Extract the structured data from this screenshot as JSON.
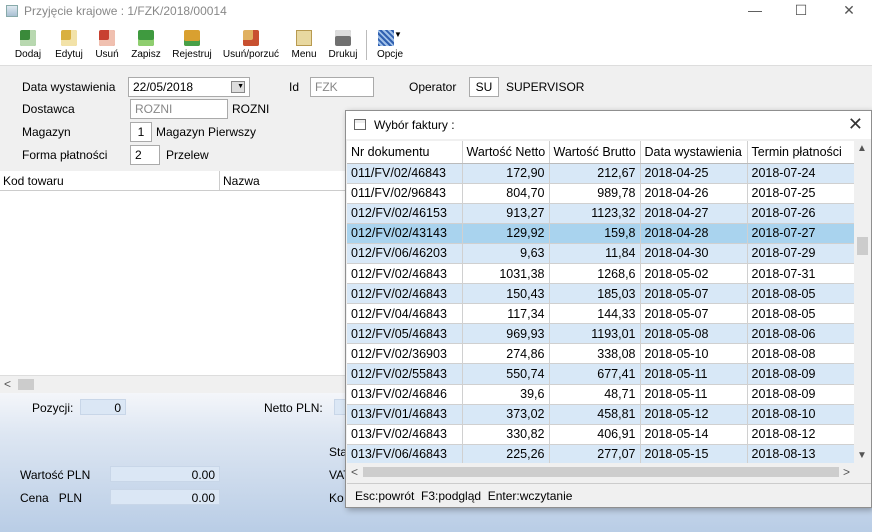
{
  "window": {
    "title": "Przyjęcie krajowe : 1/FZK/2018/00014",
    "minimize": "—",
    "maximize": "☐",
    "close": "✕"
  },
  "toolbar": {
    "buttons": [
      {
        "label": "Dodaj",
        "icon": "add-icon"
      },
      {
        "label": "Edytuj",
        "icon": "edit-icon"
      },
      {
        "label": "Usuń",
        "icon": "delete-icon"
      },
      {
        "label": "Zapisz",
        "icon": "save-icon"
      },
      {
        "label": "Rejestruj",
        "icon": "register-icon"
      },
      {
        "label": "Usuń/porzuć",
        "icon": "discard-icon"
      },
      {
        "label": "Menu",
        "icon": "menu-icon"
      },
      {
        "label": "Drukuj",
        "icon": "print-icon"
      },
      {
        "label": "Opcje",
        "icon": "options-icon"
      }
    ]
  },
  "form": {
    "date_label": "Data wystawienia",
    "date_value": "22/05/2018",
    "id_label": "Id",
    "id_value": "FZK",
    "operator_label": "Operator",
    "operator_code": "SU",
    "operator_name": "SUPERVISOR",
    "supplier_label": "Dostawca",
    "supplier_value": "ROZNI",
    "supplier_name": "ROZNI",
    "warehouse_label": "Magazyn",
    "warehouse_code": "1",
    "warehouse_name": "Magazyn Pierwszy",
    "payment_label": "Forma płatności",
    "payment_code": "2",
    "payment_name": "Przelew"
  },
  "items_grid": {
    "columns": [
      "Kod towaru",
      "Nazwa"
    ]
  },
  "footer": {
    "positions_label": "Pozycji:",
    "positions_value": "0",
    "netto_label": "Netto PLN:",
    "value_label": "Wartość PLN",
    "value_value": "0.00",
    "price_label": "Cena   PLN",
    "price_value": "0.00",
    "partial_sta": "Sta",
    "partial_vat": "VAT",
    "partial_ko": "Ko"
  },
  "dialog": {
    "title": "Wybór faktury :",
    "close": "✕",
    "columns": [
      "Nr dokumentu",
      "Wartość Netto",
      "Wartość Brutto",
      "Data wystawienia",
      "Termin płatności"
    ],
    "rows": [
      [
        "011/FV/02/46843",
        "172,90",
        "212,67",
        "2018-04-25",
        "2018-07-24"
      ],
      [
        "011/FV/02/96843",
        "804,70",
        "989,78",
        "2018-04-26",
        "2018-07-25"
      ],
      [
        "012/FV/02/46153",
        "913,27",
        "1123,32",
        "2018-04-27",
        "2018-07-26"
      ],
      [
        "012/FV/02/43143",
        "129,92",
        "159,8",
        "2018-04-28",
        "2018-07-27"
      ],
      [
        "012/FV/06/46203",
        "9,63",
        "11,84",
        "2018-04-30",
        "2018-07-29"
      ],
      [
        "012/FV/02/46843",
        "1031,38",
        "1268,6",
        "2018-05-02",
        "2018-07-31"
      ],
      [
        "012/FV/02/46843",
        "150,43",
        "185,03",
        "2018-05-07",
        "2018-08-05"
      ],
      [
        "012/FV/04/46843",
        "117,34",
        "144,33",
        "2018-05-07",
        "2018-08-05"
      ],
      [
        "012/FV/05/46843",
        "969,93",
        "1193,01",
        "2018-05-08",
        "2018-08-06"
      ],
      [
        "012/FV/02/36903",
        "274,86",
        "338,08",
        "2018-05-10",
        "2018-08-08"
      ],
      [
        "012/FV/02/55843",
        "550,74",
        "677,41",
        "2018-05-11",
        "2018-08-09"
      ],
      [
        "013/FV/02/46846",
        "39,6",
        "48,71",
        "2018-05-11",
        "2018-08-09"
      ],
      [
        "013/FV/01/46843",
        "373,02",
        "458,81",
        "2018-05-12",
        "2018-08-10"
      ],
      [
        "013/FV/02/46843",
        "330,82",
        "406,91",
        "2018-05-14",
        "2018-08-12"
      ],
      [
        "013/FV/06/46843",
        "225,26",
        "277,07",
        "2018-05-15",
        "2018-08-13"
      ]
    ],
    "selected_row": 3,
    "status": "Esc:powrót  F3:podgląd  Enter:wczytanie"
  }
}
